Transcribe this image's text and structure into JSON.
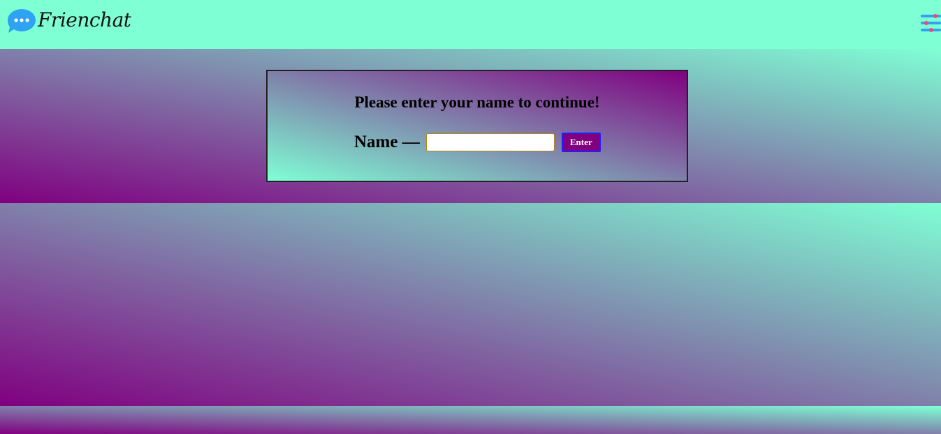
{
  "header": {
    "app_name": "Frienchat",
    "logo_icon": "chat-bubble-icon",
    "menu_icon": "sliders-menu-icon"
  },
  "login": {
    "prompt": "Please enter your name to continue!",
    "name_label": "Name —",
    "name_value": "",
    "enter_label": "Enter"
  },
  "colors": {
    "header_bg": "#7fffd4",
    "gradient_purple": "#800080",
    "gradient_aqua": "#7fffd4",
    "logo_blue": "#2ea3f2",
    "button_bg": "#800080",
    "button_border": "#1e1eff",
    "slider_knob": "#e84a7f"
  }
}
